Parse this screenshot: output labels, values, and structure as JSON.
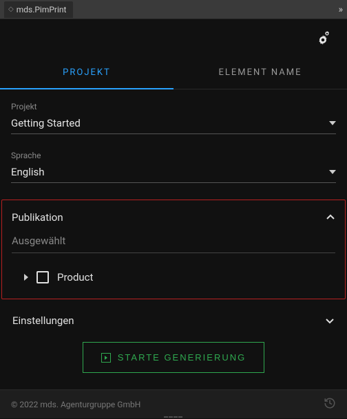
{
  "window": {
    "title": "mds.PimPrint"
  },
  "tabs": {
    "project": "PROJEKT",
    "element": "ELEMENT NAME"
  },
  "fields": {
    "project": {
      "label": "Projekt",
      "value": "Getting Started"
    },
    "language": {
      "label": "Sprache",
      "value": "English"
    }
  },
  "publication": {
    "title": "Publikation",
    "selected_label": "Ausgewählt",
    "tree": {
      "item0": {
        "label": "Product",
        "checked": false
      }
    }
  },
  "settings": {
    "title": "Einstellungen"
  },
  "actions": {
    "generate": "STARTE GENERIERUNG"
  },
  "footer": {
    "copyright": "© 2022 mds. Agenturgruppe GmbH"
  }
}
